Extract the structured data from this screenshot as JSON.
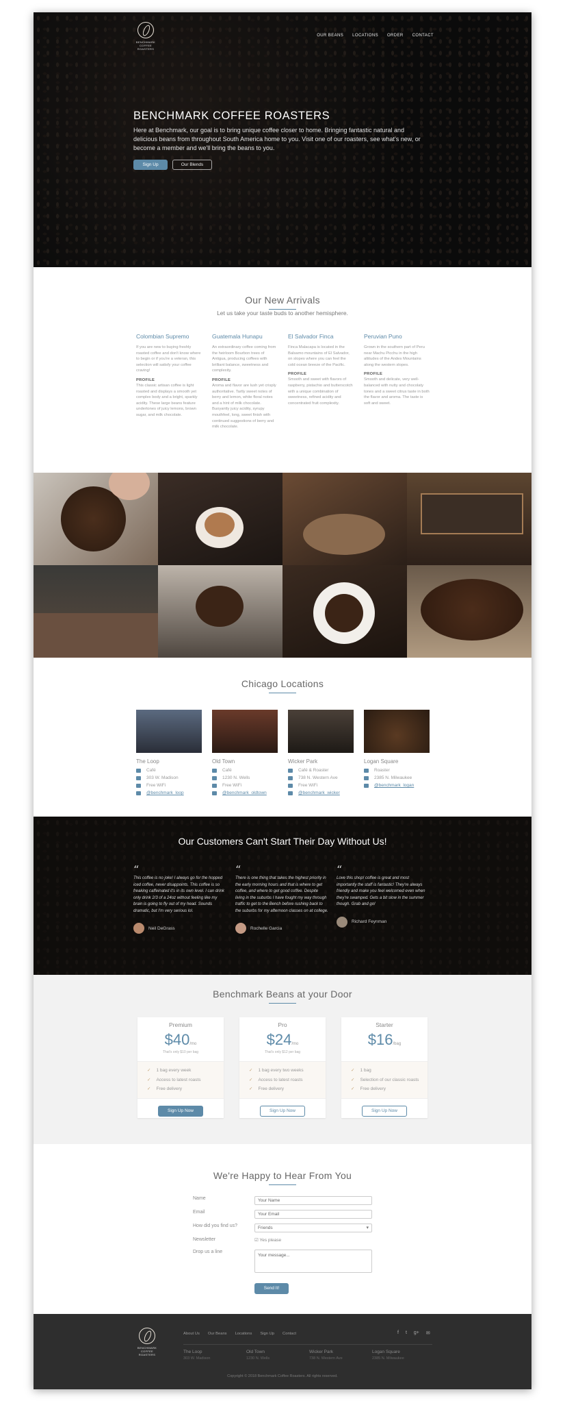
{
  "brand": {
    "name": "BENCHMARK",
    "tagline": "COFFEE ROASTERS"
  },
  "nav": [
    "OUR BEANS",
    "LOCATIONS",
    "ORDER",
    "CONTACT"
  ],
  "hero": {
    "title": "BENCHMARK COFFEE ROASTERS",
    "text": "Here at Benchmark, our goal is to bring unique coffee closer to home. Bringing fantastic natural and delicious beans from throughout South America home to you. Visit one of our roasters, see what's new, or become a member and we'll bring the beans to you.",
    "primary_button": "Sign Up",
    "secondary_button": "Our Blends"
  },
  "arrivals": {
    "title": "Our New Arrivals",
    "subtitle": "Let us take your taste buds to another hemisphere.",
    "items": [
      {
        "name": "Colombian Supremo",
        "desc": "If you are new to buying freshly roasted coffee and don't know where to begin or if you're a veteran, this selection will satisfy your coffee craving!",
        "profile_label": "PROFILE",
        "profile": "This classic artisan coffee is light roasted and displays a smooth yet complex body and a bright, sparkly acidity. These large beans feature undertones of juicy lemons, brown sugar, and milk chocolate."
      },
      {
        "name": "Guatemala Hunapu",
        "desc": "An extraordinary coffee coming from the heirloom Bourbon trees of Antigua, producing coffees with brilliant balance, sweetness and complexity.",
        "profile_label": "PROFILE",
        "profile": "Aroma and flavor are lush yet crisply authoritative. Tartly sweet notes of berry and lemon, white floral notes and a hint of milk chocolate. Buoyantly juicy acidity, syrupy mouthfeel, long, sweet finish with continued suggestions of berry and milk chocolate."
      },
      {
        "name": "El Salvador Finca",
        "desc": "Finca Malacapa is located in the Balsamo mountains of El Salvador, on slopes where you can feel the cold ocean breeze of the Pacific.",
        "profile_label": "PROFILE",
        "profile": "Smooth and sweet with flavors of raspberry, pistachio and butterscotch with a unique combination of sweetness, refined acidity and concentrated fruit complexity."
      },
      {
        "name": "Peruvian Puno",
        "desc": "Grown in the southern part of Peru near Machu Picchu in the high altitudes of the Andes Mountains along the western slopes.",
        "profile_label": "PROFILE",
        "profile": "Smooth and delicate, very well-balanced with nutty and chocolaty tones and a sweet citrus taste in both the flavor and aroma. The taste is soft and sweet."
      }
    ]
  },
  "locations": {
    "title": "Chicago Locations",
    "items": [
      {
        "name": "The Loop",
        "type": "Café",
        "address": "303 W. Madison",
        "wifi": "Free WiFi",
        "twitter": "@benchmark_loop"
      },
      {
        "name": "Old Town",
        "type": "Café",
        "address": "1230 N. Wells",
        "wifi": "Free WiFi",
        "twitter": "@benchmark_oldtown"
      },
      {
        "name": "Wicker Park",
        "type": "Café & Roaster",
        "address": "738 N. Western Ave",
        "wifi": "Free WiFi",
        "twitter": "@benchmark_wicker"
      },
      {
        "name": "Logan Square",
        "type": "Roaster",
        "address": "2385 N. Milwaukee",
        "wifi": "",
        "twitter": "@benchmark_logan"
      }
    ]
  },
  "testimonials": {
    "title": "Our Customers Can't Start Their Day Without Us!",
    "quote_mark": "“",
    "items": [
      {
        "text": "This coffee is no joke! I always go for the hopped iced coffee, never disappoints. This coffee is so freaking caffeinated it's in its own level. I can drink only drink 2/3 of a 24oz without feeling like my brain is going to fly out of my head. Sounds dramatic, but I'm very serious lol.",
        "author": "Neil DeGrass"
      },
      {
        "text": "There is one thing that takes the highest priority in the early morning hours and that is where to get coffee, and where to get good coffee. Despite living in the suburbs I have fought my way through traffic to get to the Bench before rushing back to the suburbs for my afternoon classes on at college.",
        "author": "Rochelle Garcia"
      },
      {
        "text": "Love this shop! coffee is great and most importantly the staff is fantastic! They're always friendly and make you feel welcomed even when they're swamped. Gets a bit slow in the summer though. Grab and go!",
        "author": "Richard Feynman"
      }
    ]
  },
  "pricing": {
    "title": "Benchmark Beans at your Door",
    "plans": [
      {
        "name": "Premium",
        "price": "$40",
        "unit": "/mo",
        "sub": "That's only $10 per bag",
        "features": [
          "1 bag every week",
          "Access to latest roasts",
          "Free delivery"
        ],
        "button": "Sign Up Now",
        "featured": true
      },
      {
        "name": "Pro",
        "price": "$24",
        "unit": "/mo",
        "sub": "That's only $12 per bag",
        "features": [
          "1 bag every two weeks",
          "Access to latest roasts",
          "Free delivery"
        ],
        "button": "Sign Up Now",
        "featured": false
      },
      {
        "name": "Starter",
        "price": "$16",
        "unit": "/bag",
        "sub": "",
        "features": [
          "1 bag",
          "Selection of our classic roasts",
          "Free delivery"
        ],
        "button": "Sign Up Now",
        "featured": false
      }
    ]
  },
  "contact": {
    "title": "We're Happy to Hear From You",
    "labels": {
      "name": "Name",
      "email": "Email",
      "how": "How did you find us?",
      "newsletter": "Newsletter",
      "message": "Drop us a line"
    },
    "placeholders": {
      "name": "Your Name",
      "email": "Your Email",
      "message": "Your message..."
    },
    "how_selected": "Friends",
    "newsletter_option": "Yes please",
    "send": "Send It!"
  },
  "footer": {
    "links": [
      "About Us",
      "Our Beans",
      "Locations",
      "Sign Up",
      "Contact"
    ],
    "social": [
      "f",
      "t",
      "g+",
      "✉"
    ],
    "locations": [
      {
        "name": "The Loop",
        "address": "303 W. Madison"
      },
      {
        "name": "Old Town",
        "address": "1230 N. Wells"
      },
      {
        "name": "Wicker Park",
        "address": "738 N. Western Ave"
      },
      {
        "name": "Logan Square",
        "address": "2385 N. Milwaukee"
      }
    ],
    "copyright": "Copyright © 2018 Benchmark Coffee Roasters. All rights reserved."
  },
  "colors": {
    "accent": "#5d8aa8",
    "dark": "#2e2e2e",
    "gold": "#c6a678"
  }
}
